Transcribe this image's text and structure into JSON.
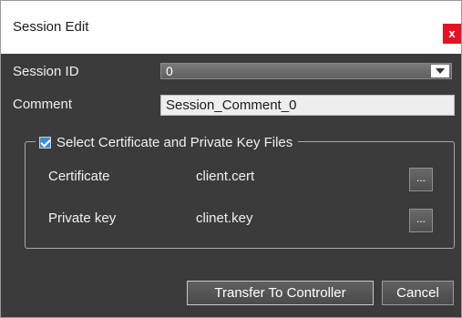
{
  "window": {
    "title": "Session Edit",
    "close_glyph": "x"
  },
  "form": {
    "session_id_label": "Session ID",
    "session_id_value": "0",
    "comment_label": "Comment",
    "comment_value": "Session_Comment_0"
  },
  "group": {
    "checkbox_label": "Select Certificate and Private Key Files",
    "checked": true,
    "certificate_label": "Certificate",
    "certificate_value": "client.cert",
    "private_key_label": "Private key",
    "private_key_value": "clinet.key",
    "browse_label": "..."
  },
  "footer": {
    "transfer_label": "Transfer To Controller",
    "cancel_label": "Cancel"
  },
  "colors": {
    "background": "#3b3b3b",
    "close_button": "#e81123",
    "checkbox": "#3a8be0"
  }
}
